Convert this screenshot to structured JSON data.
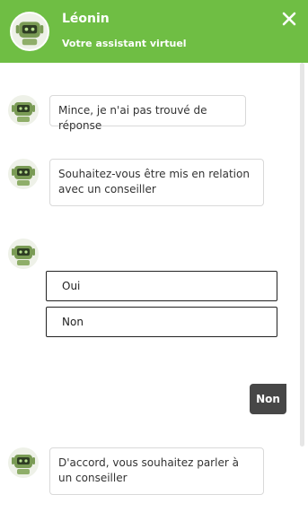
{
  "header": {
    "bot_name": "Léonin",
    "subtitle": "Votre assistant virtuel",
    "close_icon": "close-icon",
    "avatar_icon": "robot-icon"
  },
  "colors": {
    "brand_green": "#6fbe44",
    "user_bubble": "#474747",
    "robot_body": "#7a9b55"
  },
  "messages": [
    {
      "from": "bot",
      "text": "Mince, je n'ai pas trouvé de réponse"
    },
    {
      "from": "bot",
      "text": "Souhaitez-vous être mis en relation avec un conseiller"
    },
    {
      "from": "bot",
      "options": [
        "Oui",
        "Non"
      ]
    },
    {
      "from": "user",
      "text": "Non"
    },
    {
      "from": "bot",
      "text": "D'accord, vous souhaitez parler à un conseiller"
    }
  ]
}
